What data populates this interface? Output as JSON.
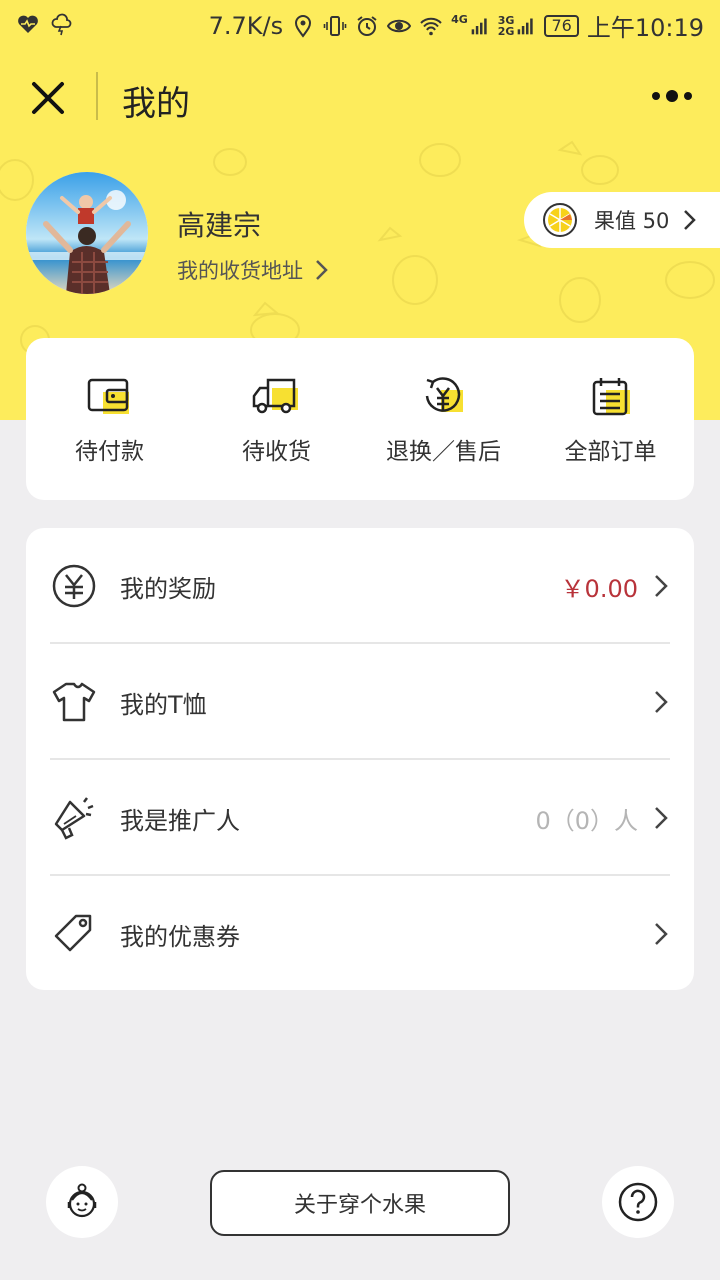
{
  "status_bar": {
    "speed": "7.7K/s",
    "net_4g": "4G",
    "net_3g_top": "3G",
    "net_3g_bottom": "2G",
    "battery": "76",
    "time": "上午10:19"
  },
  "nav": {
    "title": "我的"
  },
  "profile": {
    "name": "高建宗",
    "address_link": "我的收货地址",
    "fruit_value_label": "果值 50"
  },
  "orders": [
    {
      "label": "待付款",
      "icon": "wallet-icon"
    },
    {
      "label": "待收货",
      "icon": "truck-icon"
    },
    {
      "label": "退换／售后",
      "icon": "refund-icon"
    },
    {
      "label": "全部订单",
      "icon": "order-list-icon"
    }
  ],
  "menu": [
    {
      "label": "我的奖励",
      "value": "￥0.00",
      "icon": "yuan-circle-icon"
    },
    {
      "label": "我的T恤",
      "value": "",
      "icon": "tshirt-icon"
    },
    {
      "label": "我是推广人",
      "value": "0（0）人",
      "icon": "megaphone-icon"
    },
    {
      "label": "我的优惠券",
      "value": "",
      "icon": "coupon-tag-icon"
    }
  ],
  "bottom": {
    "about_label": "关于穿个水果",
    "left_icon": "customer-service-icon",
    "right_icon": "help-icon"
  },
  "colors": {
    "header_yellow": "#fdec5c",
    "accent_yellow": "#f7e031",
    "reward_red": "#b8333a",
    "muted_value": "#b5b5b5"
  }
}
